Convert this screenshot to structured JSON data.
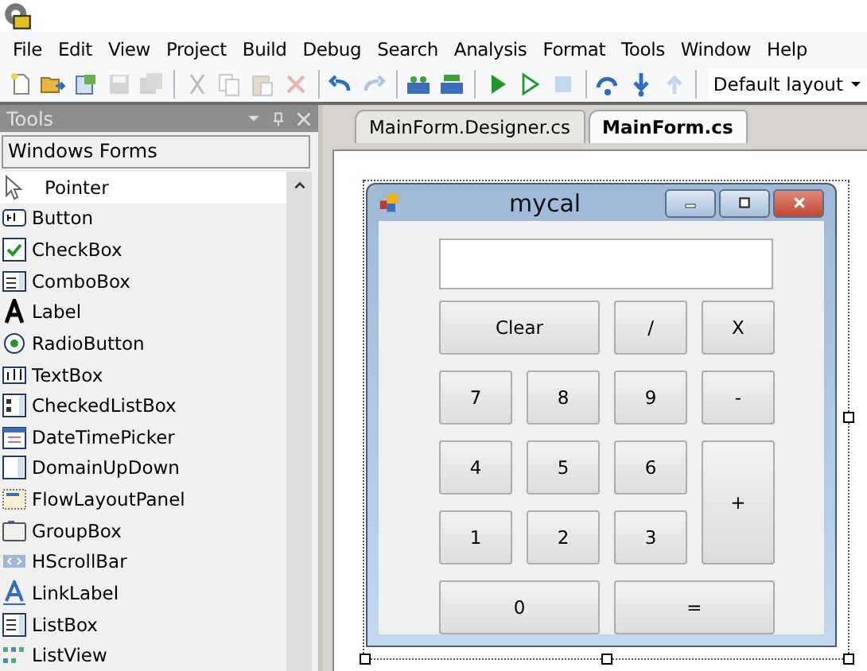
{
  "menu": [
    "File",
    "Edit",
    "View",
    "Project",
    "Build",
    "Debug",
    "Search",
    "Analysis",
    "Format",
    "Tools",
    "Window",
    "Help"
  ],
  "toolbar": {
    "buttons": [
      {
        "disabled": false
      },
      {
        "disabled": false
      },
      {
        "disabled": false
      },
      {
        "disabled": true
      },
      {
        "disabled": true
      },
      {
        "disabled": true
      },
      {
        "disabled": true
      },
      {
        "disabled": true
      },
      {
        "disabled": true
      },
      {
        "disabled": false
      },
      {
        "disabled": true
      },
      {
        "disabled": false
      },
      {
        "disabled": false
      },
      {
        "disabled": false
      },
      {
        "disabled": false
      },
      {
        "disabled": true
      },
      {
        "disabled": false
      },
      {
        "disabled": false
      },
      {
        "disabled": true
      }
    ],
    "layout": "Default layout"
  },
  "tools": {
    "title": "Tools",
    "category": "Windows Forms",
    "items": [
      {
        "label": "Pointer",
        "selected": true
      },
      {
        "label": "Button",
        "selected": false
      },
      {
        "label": "CheckBox",
        "selected": false
      },
      {
        "label": "ComboBox",
        "selected": false
      },
      {
        "label": "Label",
        "selected": false
      },
      {
        "label": "RadioButton",
        "selected": false
      },
      {
        "label": "TextBox",
        "selected": false
      },
      {
        "label": "CheckedListBox",
        "selected": false
      },
      {
        "label": "DateTimePicker",
        "selected": false
      },
      {
        "label": "DomainUpDown",
        "selected": false
      },
      {
        "label": "FlowLayoutPanel",
        "selected": false
      },
      {
        "label": "GroupBox",
        "selected": false
      },
      {
        "label": "HScrollBar",
        "selected": false
      },
      {
        "label": "LinkLabel",
        "selected": false
      },
      {
        "label": "ListBox",
        "selected": false
      },
      {
        "label": "ListView",
        "selected": false
      }
    ]
  },
  "tabs": [
    {
      "label": "MainForm.Designer.cs",
      "selected": false
    },
    {
      "label": "MainForm.cs",
      "selected": true
    }
  ],
  "form": {
    "title": "mycal",
    "buttons": [
      "Clear",
      "/",
      "X",
      "7",
      "8",
      "9",
      "-",
      "4",
      "5",
      "6",
      "+",
      "1",
      "2",
      "3",
      "0",
      "="
    ]
  }
}
